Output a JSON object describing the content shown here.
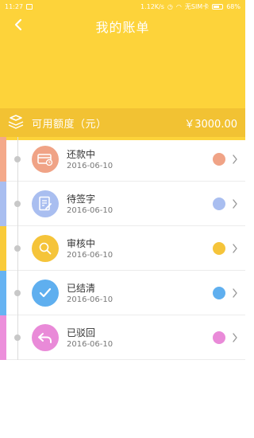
{
  "status_bar": {
    "time": "11:27",
    "network": "1.12K/s",
    "carrier": "无SIM卡",
    "battery": "68%"
  },
  "nav": {
    "title": "我的账单",
    "back_icon": "chevron-left-icon"
  },
  "credit": {
    "label": "可用额度（元）",
    "amount": "￥3000.00",
    "icon": "coin-stack-icon"
  },
  "bills": [
    {
      "status": "还款中",
      "date": "2016-06-10",
      "color": "#F0A386",
      "icon": "card-icon"
    },
    {
      "status": "待签字",
      "date": "2016-06-10",
      "color": "#A9BEF0",
      "icon": "document-sign-icon"
    },
    {
      "status": "审核中",
      "date": "2016-06-10",
      "color": "#F5C43A",
      "icon": "search-icon"
    },
    {
      "status": "已结清",
      "date": "2016-06-10",
      "color": "#5FAFEF",
      "icon": "check-icon"
    },
    {
      "status": "已驳回",
      "date": "2016-06-10",
      "color": "#E98AD8",
      "icon": "undo-arrow-icon"
    }
  ],
  "colors": {
    "header": "#FDD33A",
    "credit_bar": "#F2C233"
  }
}
